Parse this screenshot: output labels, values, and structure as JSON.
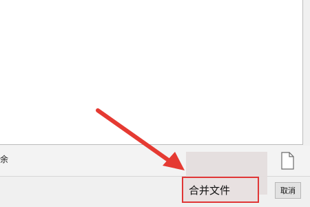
{
  "window": {
    "title": ""
  },
  "toolbar": {
    "left_text": "余",
    "file_icon": "document-icon"
  },
  "dialog": {
    "merge_button_label": "合并文件",
    "cancel_button_label": "取消"
  },
  "annotation": {
    "arrow_color": "#e53a32"
  }
}
